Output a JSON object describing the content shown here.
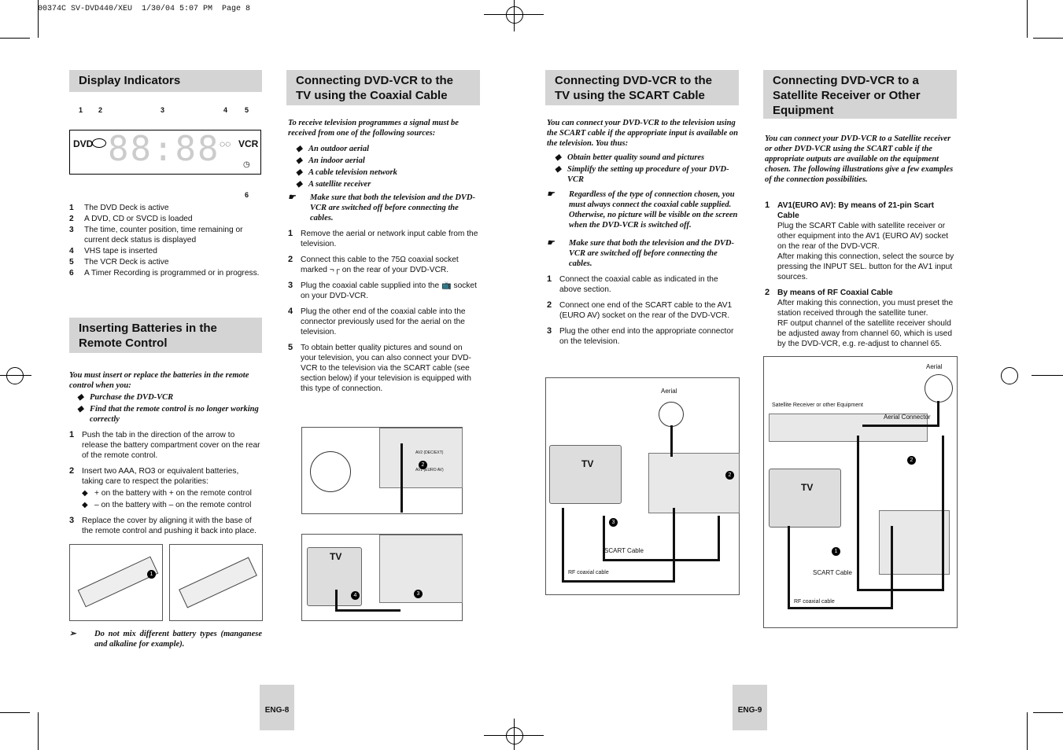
{
  "header_line": "00374C SV-DVD440/XEU  1/30/04 5:07 PM  Page 8",
  "display": {
    "title": "Display Indicators",
    "callouts": [
      "1",
      "2",
      "3",
      "4",
      "5",
      "6"
    ],
    "panel": {
      "left": "DVD",
      "right": "VCR",
      "digits": "88:88"
    },
    "items": [
      {
        "n": "1",
        "t": "The DVD Deck is active"
      },
      {
        "n": "2",
        "t": "A DVD, CD or SVCD is loaded"
      },
      {
        "n": "3",
        "t": "The time, counter position, time remaining or current deck status is displayed"
      },
      {
        "n": "4",
        "t": "VHS tape is inserted"
      },
      {
        "n": "5",
        "t": "The VCR Deck is active"
      },
      {
        "n": "6",
        "t": "A Timer Recording is programmed or in progress."
      }
    ]
  },
  "batteries": {
    "title": "Inserting Batteries in the Remote Control",
    "intro": "You must insert or replace the batteries in the remote control when you:",
    "bullets": [
      "Purchase the DVD-VCR",
      "Find that the remote control is no longer working correctly"
    ],
    "steps": [
      {
        "n": "1",
        "t": "Push the tab in the direction of the arrow to release the battery compartment cover on the rear of the remote control."
      },
      {
        "n": "2",
        "t": "Insert two AAA, RO3 or equivalent batteries, taking care to respect the polarities:",
        "sub": [
          "+ on the battery with + on the remote control",
          "– on the battery with – on the remote control"
        ]
      },
      {
        "n": "3",
        "t": "Replace the cover by aligning it with the base of the remote control and pushing it back into place."
      }
    ],
    "fig_callout": "1",
    "note": "Do not mix different battery types (manganese and alkaline for example)."
  },
  "coaxial": {
    "title": "Connecting DVD-VCR to the TV using the Coaxial Cable",
    "intro": "To receive television programmes a signal must be received from one of the following sources:",
    "bullets": [
      "An outdoor aerial",
      "An indoor aerial",
      "A cable television network",
      "A satellite receiver"
    ],
    "note": "Make sure that both the television and the DVD-VCR are switched off before connecting the cables.",
    "steps": [
      {
        "n": "1",
        "t": "Remove the aerial or network input cable from the television."
      },
      {
        "n": "2",
        "t": "Connect this cable to the 75Ω coaxial socket marked ¬┌ on the rear of your DVD-VCR."
      },
      {
        "n": "3",
        "t": "Plug the coaxial cable supplied into the 📺 socket on your DVD-VCR."
      },
      {
        "n": "4",
        "t": "Plug the other end of the coaxial cable into the connector previously used for the aerial on the television."
      },
      {
        "n": "5",
        "t": "To obtain better quality pictures and sound on your television, you can also connect your DVD-VCR to the television via the SCART cable (see section below) if your television is equipped with this type of connection."
      }
    ],
    "fig": {
      "tv": "TV",
      "callouts": [
        "2",
        "4",
        "3"
      ],
      "socket1": "AV1 (EURO AV)",
      "socket2": "AV2 (DEC/EXT)"
    }
  },
  "scart": {
    "title": "Connecting DVD-VCR to the TV using the SCART Cable",
    "intro": "You can connect your DVD-VCR to the television using the SCART cable if the appropriate input is available on the television. You thus:",
    "bullets": [
      "Obtain better quality sound and pictures",
      "Simplify the setting up procedure of your DVD-VCR"
    ],
    "notes": [
      "Regardless of the type of connection chosen, you must always connect the coaxial cable supplied. Otherwise, no picture will be visible on the screen when the DVD-VCR is switched off.",
      "Make sure that both the television and the DVD-VCR are switched off before connecting the cables."
    ],
    "steps": [
      {
        "n": "1",
        "t": "Connect the coaxial cable as indicated in the above section."
      },
      {
        "n": "2",
        "t": "Connect one end of the SCART cable to the AV1 (EURO AV) socket on the rear of the DVD-VCR."
      },
      {
        "n": "3",
        "t": "Plug the other end into the appropriate connector on the television."
      }
    ],
    "fig": {
      "aerial": "Aerial",
      "tv": "TV",
      "scart": "SCART Cable",
      "rf": "RF coaxial cable",
      "callouts": [
        "2",
        "3"
      ]
    }
  },
  "satellite": {
    "title": "Connecting DVD-VCR to a Satellite Receiver or Other Equipment",
    "intro": "You can connect your DVD-VCR to a Satellite receiver or other DVD-VCR using the SCART cable if the appropriate outputs are available on the equipment chosen. The following illustrations give a few examples of the connection possibilities.",
    "steps": [
      {
        "n": "1",
        "h": "AV1(EURO AV): By means of 21-pin Scart Cable",
        "t": "Plug the SCART Cable with satellite receiver or other equipment into the AV1 (EURO AV) socket on the rear of the DVD-VCR.",
        "t2": "After making this connection, select the source by pressing the INPUT SEL. button for the AV1 input sources."
      },
      {
        "n": "2",
        "h": "By means of RF Coaxial Cable",
        "t": "After making this connection, you must preset the station received through the satellite tuner.",
        "t2": "RF output channel of the satellite receiver should be adjusted away from channel 60, which is used by the DVD-VCR, e.g. re-adjust to channel 65."
      }
    ],
    "fig": {
      "aerial": "Aerial",
      "receiver": "Satellite Receiver or other Equipment",
      "aerial_conn": "Aerial Connector",
      "tv": "TV",
      "scart": "SCART Cable",
      "rf": "RF coaxial cable",
      "callouts": [
        "2",
        "1"
      ]
    }
  },
  "pages": {
    "left": "ENG-8",
    "right": "ENG-9"
  }
}
